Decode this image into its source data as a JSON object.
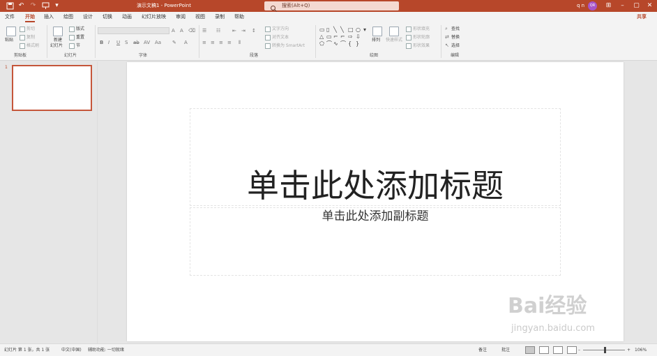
{
  "app": {
    "doc_title": "演示文稿1  -  PowerPoint",
    "search_placeholder": "搜索(Alt+Q)",
    "user_name": "q n",
    "avatar_initials": "QR",
    "accent_color": "#b7472a"
  },
  "quick_access": [
    {
      "icon": "save-icon"
    },
    {
      "icon": "undo-icon"
    },
    {
      "icon": "redo-icon"
    },
    {
      "icon": "presentation-icon"
    },
    {
      "icon": "customize-qat-icon"
    }
  ],
  "menu_tabs": [
    {
      "label": "文件",
      "active": false
    },
    {
      "label": "开始",
      "active": true
    },
    {
      "label": "插入",
      "active": false
    },
    {
      "label": "绘图",
      "active": false
    },
    {
      "label": "设计",
      "active": false
    },
    {
      "label": "切换",
      "active": false
    },
    {
      "label": "动画",
      "active": false
    },
    {
      "label": "幻灯片放映",
      "active": false
    },
    {
      "label": "审阅",
      "active": false
    },
    {
      "label": "视图",
      "active": false
    },
    {
      "label": "录制",
      "active": false
    },
    {
      "label": "帮助",
      "active": false
    }
  ],
  "share_label": "共享",
  "ribbon": {
    "clipboard": {
      "label": "剪贴板",
      "paste": "粘贴",
      "cut": "剪切",
      "copy": "复制",
      "format_painter": "格式刷"
    },
    "slides": {
      "label": "幻灯片",
      "new_slide_1": "新建",
      "new_slide_2": "幻灯片",
      "layout": "版式",
      "reset": "重置",
      "section": "节"
    },
    "font": {
      "label": "字体"
    },
    "paragraph": {
      "label": "段落",
      "text_direction": "文字方向",
      "align_text": "对齐文本",
      "smartart": "转换为 SmartArt"
    },
    "drawing": {
      "label": "绘图",
      "arrange": "排列",
      "quick_styles": "快速样式",
      "shape_fill": "形状填充",
      "shape_outline": "形状轮廓",
      "shape_effects": "形状效果"
    },
    "editing": {
      "label": "编辑",
      "find": "查找",
      "replace": "替换",
      "select": "选择"
    }
  },
  "thumbnails": [
    {
      "number": "1"
    }
  ],
  "slide": {
    "title": "单击此处添加标题",
    "subtitle": "单击此处添加副标题"
  },
  "watermark": {
    "brand": "Bai经验",
    "url": "jingyan.baidu.com"
  },
  "status": {
    "slide_info": "幻灯片 第 1 张，共 1 张",
    "language": "中文(中国)",
    "accessibility": "辅助功能: 一切就绪",
    "notes": "备注",
    "comments": "批注",
    "zoom": "106%"
  }
}
